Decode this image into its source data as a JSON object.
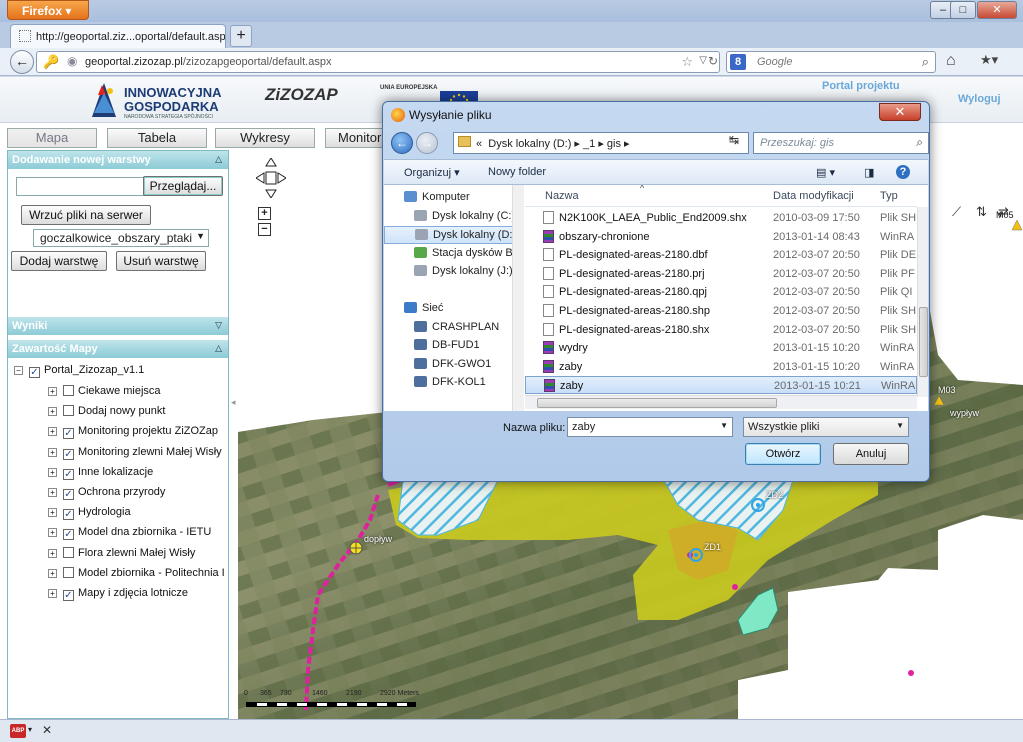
{
  "browser": {
    "menu_label": "Firefox",
    "tab_title": "http://geoportal.ziz...oportal/default.aspx",
    "url_domain": "geoportal.zizozap.pl",
    "url_path": "/zizozapgeoportal/default.aspx",
    "search_engine": "Google",
    "search_placeholder": "Google"
  },
  "banner": {
    "brand_line1": "INNOWACYJNA",
    "brand_line2": "GOSPODARKA",
    "brand_sub": "NARODOWA STRATEGIA SPÓJNOŚCI",
    "project_logo": "ZiZOZAP",
    "eu_label": "UNIA EUROPEJSKA",
    "portal_link": "Portal projektu",
    "logout_link": "Wyloguj"
  },
  "nav_tabs": [
    "Mapa",
    "Tabela",
    "Wykresy",
    "Monitori"
  ],
  "add_layer": {
    "header": "Dodawanie nowej warstwy",
    "browse_button": "Przeglądaj...",
    "upload_button": "Wrzuć pliki na serwer",
    "selected_layer": "goczalkowice_obszary_ptaki",
    "add_button": "Dodaj warstwę",
    "remove_button": "Usuń warstwę"
  },
  "results": {
    "header": "Wyniki"
  },
  "map_content": {
    "header": "Zawartość Mapy",
    "root": "Portal_Zizozap_v1.1",
    "items": [
      {
        "label": "Ciekawe miejsca",
        "checked": false
      },
      {
        "label": "Dodaj nowy punkt",
        "checked": false
      },
      {
        "label": "Monitoring projektu ZiZOZap",
        "checked": true
      },
      {
        "label": "Monitoring zlewni Małej Wisły",
        "checked": true
      },
      {
        "label": "Inne lokalizacje",
        "checked": true
      },
      {
        "label": "Ochrona przyrody",
        "checked": true
      },
      {
        "label": "Hydrologia",
        "checked": true
      },
      {
        "label": "Model dna zbiornika - IETU",
        "checked": true
      },
      {
        "label": "Flora zlewni Małej Wisły",
        "checked": false
      },
      {
        "label": "Model zbiornika - Politechnia I",
        "checked": false
      },
      {
        "label": "Mapy i zdjęcia lotnicze",
        "checked": true
      }
    ]
  },
  "map": {
    "labels": [
      "dopływ",
      "ZD1",
      "ZD2",
      "M05",
      "M03",
      "wypływ"
    ],
    "scale_ticks": [
      "0",
      "365",
      "730",
      "1460",
      "2190",
      "2920 Meters"
    ]
  },
  "dialog": {
    "title": "Wysyłanie pliku",
    "breadcrumb": [
      "«",
      "Dysk lokalny (D:)",
      "_1",
      "gis"
    ],
    "search_placeholder": "Przeszukaj: gis",
    "organize": "Organizuj",
    "new_folder": "Nowy folder",
    "nav": [
      {
        "label": "Komputer",
        "type": "computer",
        "indent": 0,
        "selected": false
      },
      {
        "label": "Dysk lokalny (C:)",
        "type": "drive",
        "indent": 1,
        "selected": false
      },
      {
        "label": "Dysk lokalny (D:)",
        "type": "drive",
        "indent": 1,
        "selected": true
      },
      {
        "label": "Stacja dysków BD",
        "type": "optical",
        "indent": 1,
        "selected": false
      },
      {
        "label": "Dysk lokalny (J:)",
        "type": "drive",
        "indent": 1,
        "selected": false
      },
      {
        "label": "",
        "type": "spacer",
        "indent": 0,
        "selected": false
      },
      {
        "label": "Sieć",
        "type": "network",
        "indent": 0,
        "selected": false
      },
      {
        "label": "CRASHPLAN",
        "type": "pc",
        "indent": 1,
        "selected": false
      },
      {
        "label": "DB-FUD1",
        "type": "pc",
        "indent": 1,
        "selected": false
      },
      {
        "label": "DFK-GWO1",
        "type": "pc",
        "indent": 1,
        "selected": false
      },
      {
        "label": "DFK-KOL1",
        "type": "pc",
        "indent": 1,
        "selected": false
      }
    ],
    "columns": [
      "Nazwa",
      "Data modyfikacji",
      "Typ"
    ],
    "files": [
      {
        "name": "N2K100K_LAEA_Public_End2009.shx",
        "date": "2010-03-09 17:50",
        "type": "Plik SH",
        "icon": "doc"
      },
      {
        "name": "obszary-chronione",
        "date": "2013-01-14 08:43",
        "type": "WinRA",
        "icon": "rar"
      },
      {
        "name": "PL-designated-areas-2180.dbf",
        "date": "2012-03-07 20:50",
        "type": "Plik DE",
        "icon": "doc"
      },
      {
        "name": "PL-designated-areas-2180.prj",
        "date": "2012-03-07 20:50",
        "type": "Plik PF",
        "icon": "doc"
      },
      {
        "name": "PL-designated-areas-2180.qpj",
        "date": "2012-03-07 20:50",
        "type": "Plik QI",
        "icon": "doc"
      },
      {
        "name": "PL-designated-areas-2180.shp",
        "date": "2012-03-07 20:50",
        "type": "Plik SH",
        "icon": "doc"
      },
      {
        "name": "PL-designated-areas-2180.shx",
        "date": "2012-03-07 20:50",
        "type": "Plik SH",
        "icon": "doc"
      },
      {
        "name": "wydry",
        "date": "2013-01-15 10:20",
        "type": "WinRA",
        "icon": "rar"
      },
      {
        "name": "zaby",
        "date": "2013-01-15 10:20",
        "type": "WinRA",
        "icon": "rar"
      },
      {
        "name": "zaby",
        "date": "2013-01-15 10:21",
        "type": "WinRA",
        "icon": "rar",
        "selected": true
      }
    ],
    "filename_label": "Nazwa pliku:",
    "filename_value": "zaby",
    "filetype": "Wszystkie pliki",
    "open_button": "Otwórz",
    "cancel_button": "Anuluj"
  },
  "colors": {
    "panel_header": "#8ccbd6",
    "river": "#e0219e",
    "protected_area": "#c8c820",
    "hatch": "#4fb7e0",
    "dialog_frame": "#b1cae9"
  }
}
